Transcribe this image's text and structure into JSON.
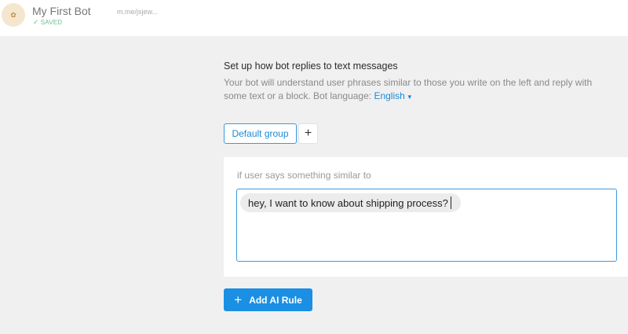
{
  "header": {
    "bot_name": "My First Bot",
    "status": "SAVED",
    "bot_link": "m.me/jsjew...",
    "avatar_icon": "bot-avatar-icon"
  },
  "section": {
    "title": "Set up how bot replies to text messages",
    "description": "Your bot will understand user phrases similar to those you write on the left and reply with some text or a block. Bot language:",
    "language": "English"
  },
  "groups": {
    "tabs": [
      {
        "label": "Default group"
      }
    ],
    "add_label": "+"
  },
  "rule": {
    "label": "if user says something similar to",
    "phrases": [
      "hey, I want to know about shipping process?"
    ]
  },
  "actions": {
    "add_ai_rule_label": "Add AI Rule"
  },
  "colors": {
    "accent": "#1a8fe3",
    "saved": "#6fbe90",
    "background": "#f0f0f0"
  }
}
